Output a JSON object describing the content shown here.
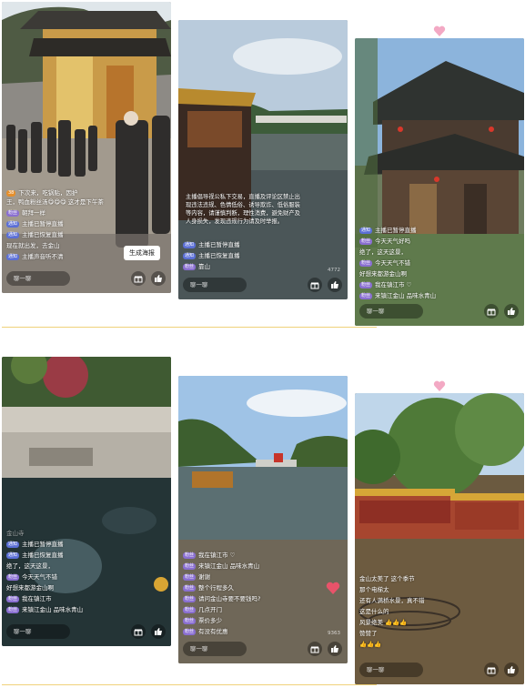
{
  "input_placeholder": "聊一聊",
  "p1": {
    "top_msg": "下次来，吃锅贴，因护",
    "top_msg2": "王，鸭血粉丝汤😋😋😋  这才是下午茶",
    "chat": [
      {
        "badge": "粉丝",
        "text": "朝拜一样"
      },
      {
        "badge": "通知",
        "text": "主播已暂停直播"
      },
      {
        "badge": "通知",
        "text": "主播已恢复直播"
      },
      {
        "badge": "",
        "text": "现在就出发，去金山"
      },
      {
        "badge": "通知",
        "text": "主播声音听不清"
      }
    ],
    "poster_button": "生成海报"
  },
  "p2": {
    "notice": "主播倡导视公私下交易，直播及评论区禁止出现违法违规、色情低俗、诱导欺诈、低俗服装等内容，请谨慎判断，理性消费，避免财产及人身损失，发现违规行为请及时举报。",
    "chat": [
      {
        "badge": "通知",
        "text": "主播已暂停直播"
      },
      {
        "badge": "通知",
        "text": "主播已恢复直播"
      },
      {
        "badge": "粉丝",
        "text": "靠山"
      }
    ],
    "count": "4772"
  },
  "p3": {
    "chat": [
      {
        "badge": "通知",
        "text": "主播已暂停直播"
      },
      {
        "badge": "粉丝",
        "text": "今天天气好吗"
      },
      {
        "badge": "",
        "text": "绝了，这天这景，"
      },
      {
        "badge": "粉丝",
        "text": "今天天气不错"
      },
      {
        "badge": "",
        "text": "好想来都游金山啊"
      },
      {
        "badge": "粉丝",
        "text": "我在镇江市 ♡"
      },
      {
        "badge": "粉丝",
        "text": "来镇江金山 品味水青山"
      }
    ]
  },
  "p4": {
    "chat": [
      {
        "badge": "",
        "text": "金山寺"
      },
      {
        "badge": "通知",
        "text": "主播已暂停直播"
      },
      {
        "badge": "通知",
        "text": "主播已恢复直播"
      },
      {
        "badge": "",
        "text": "绝了，这天这景，"
      },
      {
        "badge": "粉丝",
        "text": "今天天气不错"
      },
      {
        "badge": "",
        "text": "好想来都游金山啊"
      },
      {
        "badge": "粉丝",
        "text": "我在镇江市"
      },
      {
        "badge": "粉丝",
        "text": "来镇江金山 品味水青山"
      }
    ]
  },
  "p5": {
    "chat": [
      {
        "badge": "粉丝",
        "text": "我在镇江市 ♡"
      },
      {
        "badge": "粉丝",
        "text": "来镇江金山 品味水青山"
      },
      {
        "badge": "粉丝",
        "text": "谢谢"
      },
      {
        "badge": "粉丝",
        "text": "整个行程多久"
      },
      {
        "badge": "粉丝",
        "text": "请问金山寺要不要钱吗?"
      },
      {
        "badge": "粉丝",
        "text": "几点开门"
      },
      {
        "badge": "粉丝",
        "text": "票价多少"
      },
      {
        "badge": "粉丝",
        "text": "有没有优惠"
      }
    ],
    "count": "9363"
  },
  "p6": {
    "chat": [
      {
        "badge": "",
        "text": "金山太美了 这个季节"
      },
      {
        "badge": "",
        "text": "那个电梯太"
      },
      {
        "badge": "",
        "text": "还有人满桥水景，真不错"
      },
      {
        "badge": "",
        "text": "这是什么的"
      },
      {
        "badge": "",
        "text": "风景绝美 👍👍👍"
      },
      {
        "badge": "",
        "text": "赞赞了"
      },
      {
        "badge": "",
        "text": "👍👍👍"
      }
    ]
  },
  "colors": {
    "notice_badge": "#5b6fd6",
    "fan_badge": "#8a6fd1",
    "accent_line": "#f0d27a"
  }
}
